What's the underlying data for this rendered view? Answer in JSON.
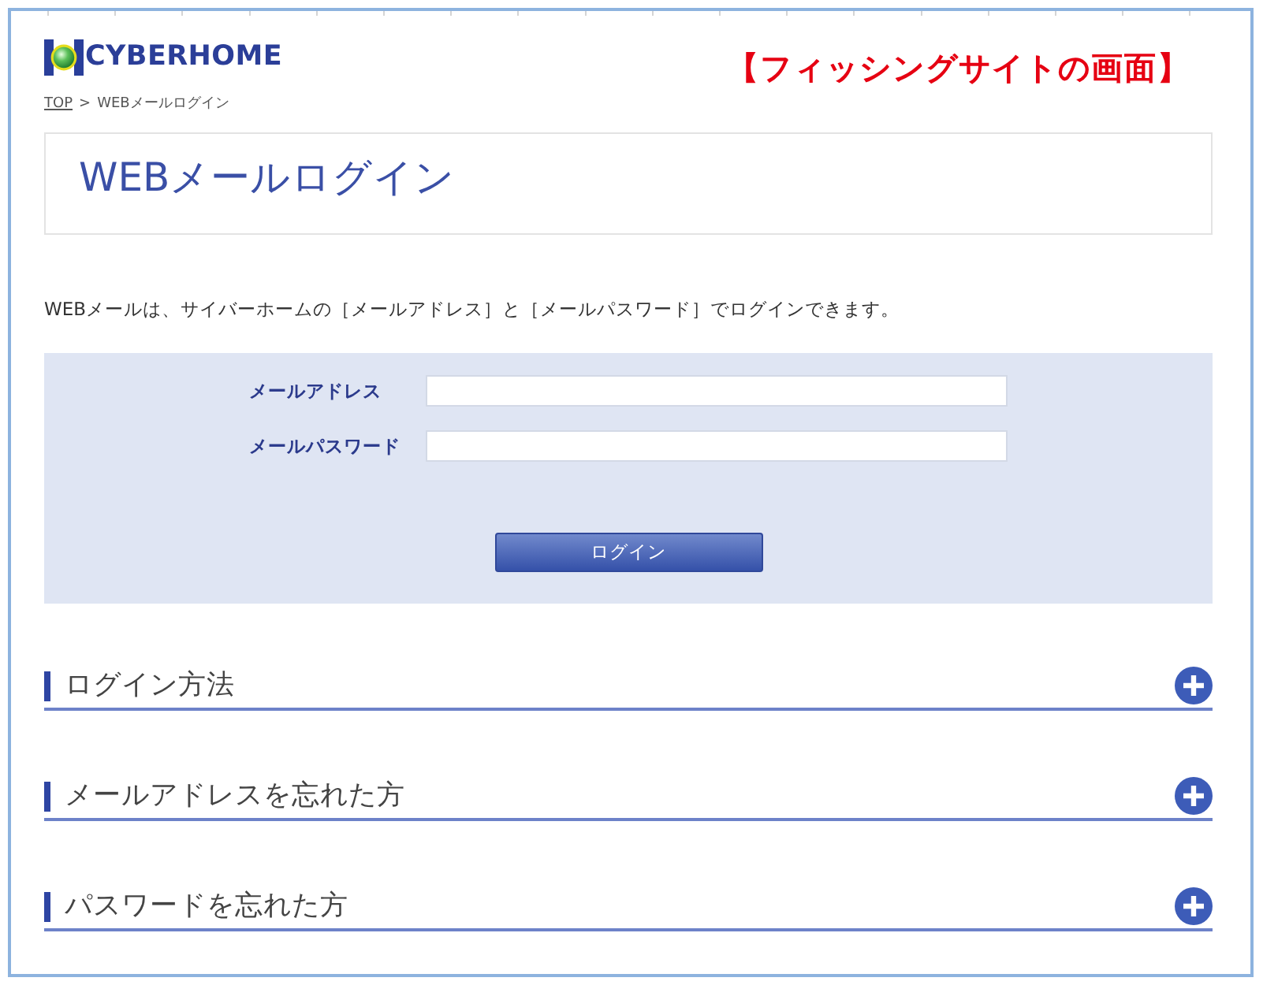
{
  "header": {
    "logo_text": "CYBERHOME",
    "annotation": "【フィッシングサイトの画面】"
  },
  "breadcrumb": {
    "separator": ">",
    "items": [
      {
        "label": "TOP",
        "kind": "link"
      },
      {
        "label": "WEBメールログイン",
        "kind": "current"
      }
    ]
  },
  "page_title": "WEBメールログイン",
  "description": "WEBメールは、サイバーホームの［メールアドレス］と［メールパスワード］でログインできます。",
  "login_form": {
    "fields": [
      {
        "label": "メールアドレス"
      },
      {
        "label": "メールパスワード"
      }
    ],
    "submit": "ログイン"
  },
  "sections": [
    {
      "title": "ログイン方法",
      "expanded": false
    },
    {
      "title": "メールアドレスを忘れた方",
      "expanded": false
    },
    {
      "title": "パスワードを忘れた方",
      "expanded": false
    }
  ]
}
